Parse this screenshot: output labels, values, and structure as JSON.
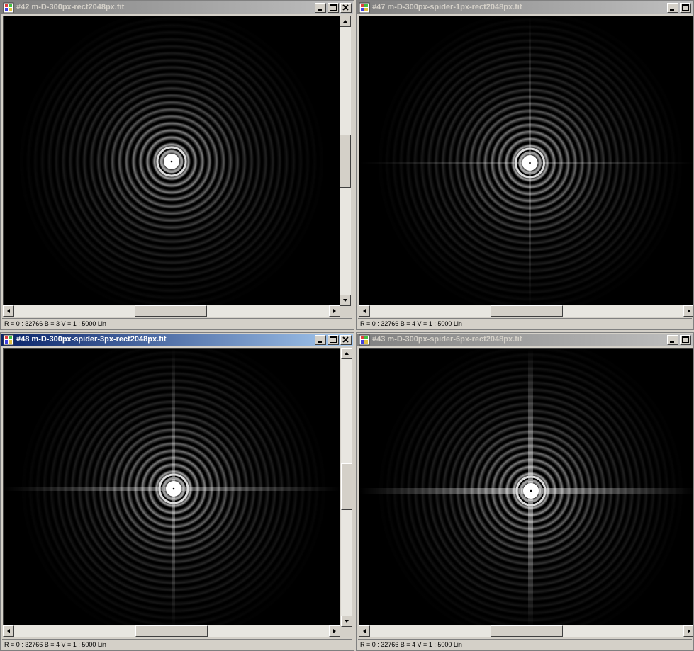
{
  "windows": [
    {
      "title": "#42 m-D-300px-rect2048px.fit",
      "status": "R = 0 : 32766   B = 3   V = 1 : 5000 Lin"
    },
    {
      "title": "#47 m-D-300px-spider-1px-rect2048px.fit",
      "status": "R = 0 : 32766   B = 4   V = 1 : 5000 Lin"
    },
    {
      "title": "#48 m-D-300px-spider-3px-rect2048px.fit",
      "status": "R = 0 : 32766   B = 4   V = 1 : 5000 Lin"
    },
    {
      "title": "#43 m-D-300px-spider-6px-rect2048px.fit",
      "status": "R = 0 : 32766   B = 4   V = 1 : 5000 Lin"
    }
  ],
  "icons": {
    "app": "palette-icon",
    "minimize": "minimize-icon",
    "maximize": "maximize-icon",
    "close": "close-icon",
    "scroll_up": "arrow-up-icon",
    "scroll_down": "arrow-down-icon",
    "scroll_left": "arrow-left-icon",
    "scroll_right": "arrow-right-icon"
  },
  "colors": {
    "active_title_start": "#0a246a",
    "active_title_end": "#a6caf0",
    "inactive_title_start": "#808080",
    "inactive_title_end": "#c0c0c0",
    "image_background": "#000000"
  }
}
